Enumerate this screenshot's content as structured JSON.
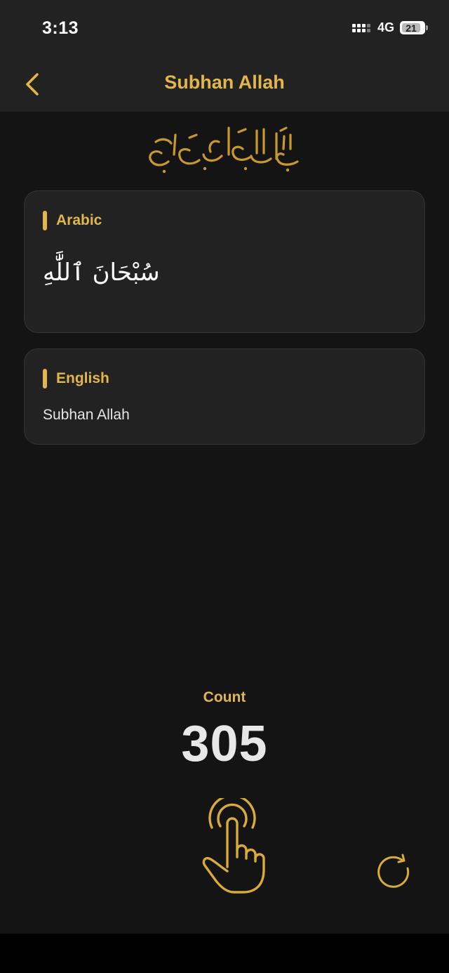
{
  "status_bar": {
    "time": "3:13",
    "network": "4G",
    "battery": "21",
    "battery_fraction": 0.21
  },
  "header": {
    "title": "Subhan Allah",
    "back_icon": "chevron-left-icon"
  },
  "bismillah": {
    "icon": "bismillah-calligraphy-icon"
  },
  "cards": {
    "arabic": {
      "label": "Arabic",
      "text": "سُبْحَانَ ٱللَّٰهِ"
    },
    "english": {
      "label": "English",
      "text": "Subhan Allah"
    }
  },
  "counter": {
    "label": "Count",
    "value": "305",
    "tap_icon": "tap-hand-icon",
    "reset_icon": "reset-icon"
  },
  "colors": {
    "accent": "#e2b64a",
    "background": "#141414",
    "surface": "#222222",
    "text": "#e8e8e8"
  }
}
